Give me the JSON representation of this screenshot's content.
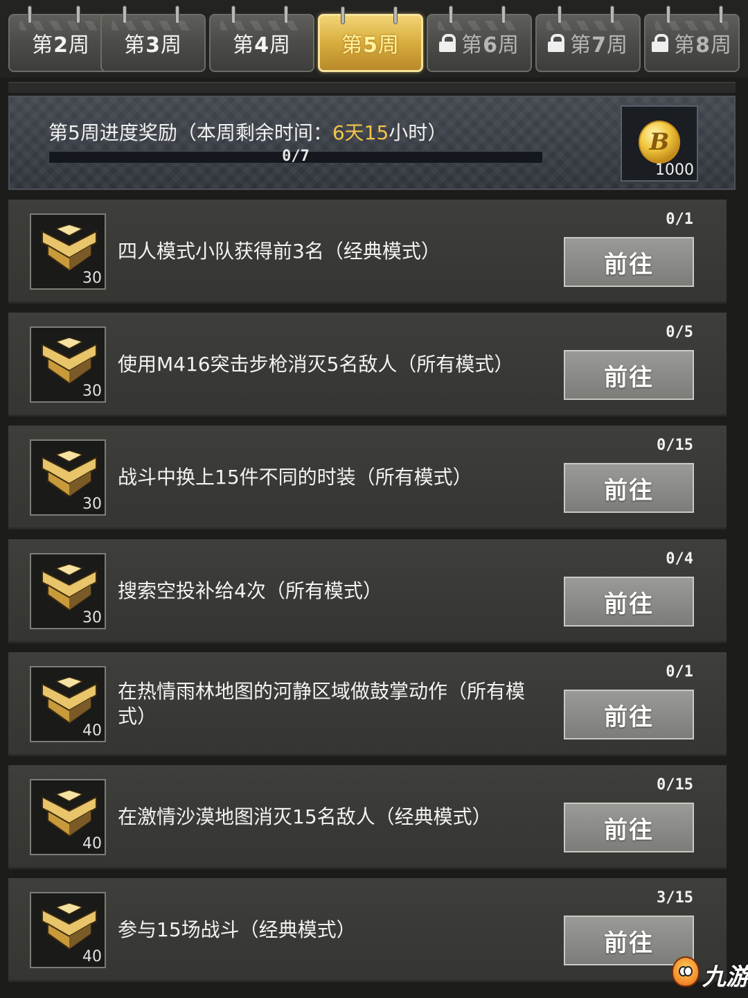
{
  "tabs": [
    {
      "prefix": "第",
      "num": "2",
      "suffix": "周",
      "state": "normal"
    },
    {
      "prefix": "第",
      "num": "3",
      "suffix": "周",
      "state": "normal"
    },
    {
      "prefix": "第",
      "num": "4",
      "suffix": "周",
      "state": "normal"
    },
    {
      "prefix": "第",
      "num": "5",
      "suffix": "周",
      "state": "active"
    },
    {
      "prefix": "第",
      "num": "6",
      "suffix": "周",
      "state": "locked"
    },
    {
      "prefix": "第",
      "num": "7",
      "suffix": "周",
      "state": "locked"
    },
    {
      "prefix": "第",
      "num": "8",
      "suffix": "周",
      "state": "locked"
    }
  ],
  "reward": {
    "title_main": "第5周进度奖励",
    "title_paren_open": "（本周剩余时间：",
    "time_left": "6天15",
    "time_unit": "小时",
    "title_paren_close": "）",
    "progress_text": "0/7",
    "progress_fraction": 0,
    "coin_amount": "1000",
    "coin_symbol": "B"
  },
  "tasks": [
    {
      "points": "30",
      "text": "四人模式小队获得前3名（经典模式）",
      "progress": "0/1",
      "button": "前往"
    },
    {
      "points": "30",
      "text": "使用M416突击步枪消灭5名敌人（所有模式）",
      "progress": "0/5",
      "button": "前往"
    },
    {
      "points": "30",
      "text": "战斗中换上15件不同的时装（所有模式）",
      "progress": "0/15",
      "button": "前往"
    },
    {
      "points": "30",
      "text": "搜索空投补给4次（所有模式）",
      "progress": "0/4",
      "button": "前往"
    },
    {
      "points": "40",
      "text": "在热情雨林地图的河静区域做鼓掌动作（所有模式）",
      "progress": "0/1",
      "button": "前往"
    },
    {
      "points": "40",
      "text": "在激情沙漠地图消灭15名敌人（经典模式）",
      "progress": "0/15",
      "button": "前往"
    },
    {
      "points": "40",
      "text": "参与15场战斗（经典模式）",
      "progress": "3/15",
      "button": "前往"
    }
  ],
  "watermark": {
    "text": "九游"
  },
  "colors": {
    "active_tab": "#d8ad3e",
    "highlight_text": "#f3c64a",
    "button": "#8c8c88",
    "background": "#1c1c1b"
  }
}
